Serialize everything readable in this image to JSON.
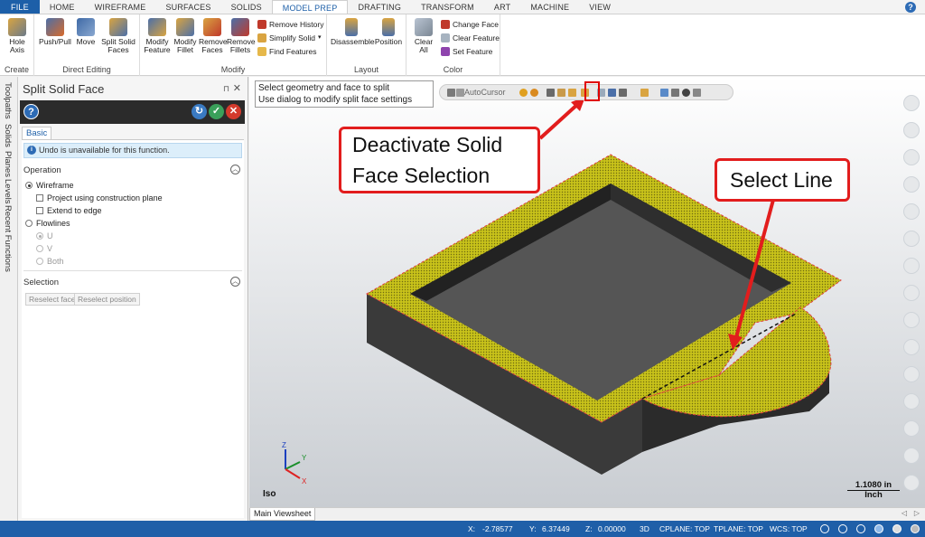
{
  "menu": {
    "tabs": [
      "FILE",
      "HOME",
      "WIREFRAME",
      "SURFACES",
      "SOLIDS",
      "MODEL PREP",
      "DRAFTING",
      "TRANSFORM",
      "ART",
      "MACHINE",
      "VIEW"
    ],
    "active_tab": "MODEL PREP",
    "help_label": "?"
  },
  "ribbon": {
    "groups": {
      "create": "Create",
      "direct_editing": "Direct Editing",
      "modify": "Modify",
      "layout": "Layout",
      "color": "Color"
    },
    "buttons": {
      "hole_axis": [
        "Hole",
        "Axis"
      ],
      "push_pull": [
        "Push/Pull"
      ],
      "move": [
        "Move"
      ],
      "split_solid_faces": [
        "Split Solid",
        "Faces"
      ],
      "modify_feature": [
        "Modify",
        "Feature"
      ],
      "modify_fillet": [
        "Modify",
        "Fillet"
      ],
      "remove_faces": [
        "Remove",
        "Faces"
      ],
      "remove_fillets": [
        "Remove",
        "Fillets"
      ],
      "remove_history": "Remove History",
      "simplify_solid": "Simplify Solid",
      "find_features": "Find Features",
      "disassemble": [
        "Disassemble"
      ],
      "position": [
        "Position"
      ],
      "clear_all": [
        "Clear",
        "All"
      ],
      "change_face": "Change Face",
      "clear_feature": "Clear Feature",
      "set_feature": "Set Feature"
    }
  },
  "side_tabs": [
    "Toolpaths",
    "Solids",
    "Planes",
    "Levels",
    "Recent Functions"
  ],
  "panel": {
    "title": "Split Solid Face",
    "pin": "⊓",
    "close": "✕",
    "tab": "Basic",
    "info": "Undo is unavailable for this function.",
    "operation": {
      "heading": "Operation",
      "wireframe": "Wireframe",
      "project": "Project using construction plane",
      "extend": "Extend to edge",
      "flowlines": "Flowlines",
      "u": "U",
      "v": "V",
      "both": "Both"
    },
    "selection": {
      "heading": "Selection",
      "reselect_face": "Reselect face",
      "reselect_position": "Reselect position"
    }
  },
  "viewport": {
    "prompt_line1": "Select geometry and face to split",
    "prompt_line2": "Use dialog to modify split face settings",
    "autocursor": "AutoCursor",
    "callout_deactivate": [
      "Deactivate Solid",
      "Face Selection"
    ],
    "callout_select_line": "Select Line",
    "scale_value": "1.1080 in",
    "scale_unit": "Inch",
    "view_name": "Iso",
    "axes": {
      "x": "X",
      "y": "Y",
      "z": "Z"
    }
  },
  "sheet_tab": "Main Viewsheet",
  "status": {
    "x_label": "X:",
    "x_value": "-2.78577",
    "y_label": "Y:",
    "y_value": "6.37449",
    "z_label": "Z:",
    "z_value": "0.00000",
    "mode": "3D",
    "cplane": "CPLANE: TOP",
    "tplane": "TPLANE: TOP",
    "wcs": "WCS: TOP"
  },
  "colors": {
    "accent": "#1d5fa8",
    "callout_red": "#e21d1d",
    "face_yellow": "#c8c21a",
    "solid_dark": "#3a3a3a"
  }
}
